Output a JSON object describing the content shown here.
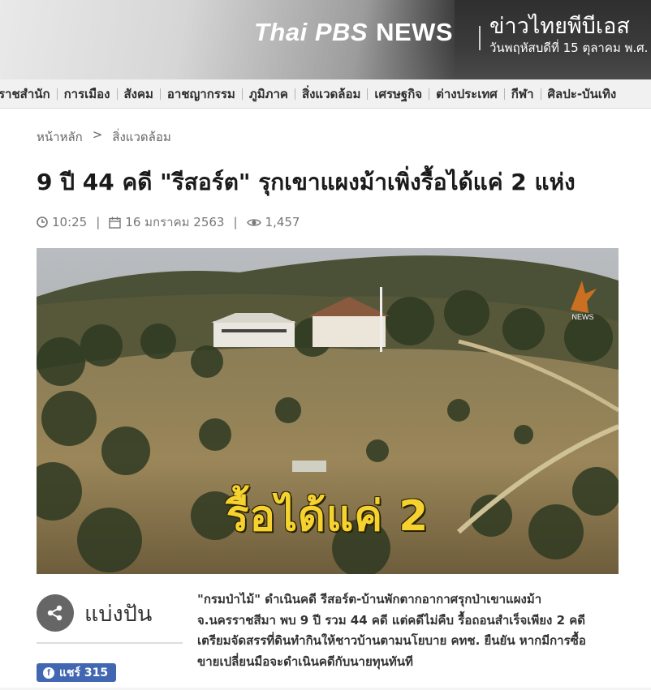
{
  "header": {
    "logo_brand": "Thai PBS",
    "logo_news": "NEWS",
    "thai_name": "ข่าวไทยพีบีเอส",
    "date_text": "วันพฤหัสบดีที่ 15 ตุลาคม พ.ศ."
  },
  "nav": {
    "items": [
      {
        "label": "ราชสำนัก"
      },
      {
        "label": "การเมือง"
      },
      {
        "label": "สังคม"
      },
      {
        "label": "อาชญากรรม"
      },
      {
        "label": "ภูมิภาค"
      },
      {
        "label": "สิ่งแวดล้อม"
      },
      {
        "label": "เศรษฐกิจ"
      },
      {
        "label": "ต่างประเทศ"
      },
      {
        "label": "กีฬา"
      },
      {
        "label": "ศิลปะ-บันเทิง"
      }
    ]
  },
  "breadcrumb": {
    "home": "หน้าหลัก",
    "separator": ">",
    "current": "สิ่งแวดล้อม"
  },
  "article": {
    "title": "9 ปี 44 คดี \"รีสอร์ต\" รุกเขาแผงม้าเพิ่งรื้อได้แค่ 2 แห่ง",
    "time": "10:25",
    "date": "16 มกราคม 2563",
    "views": "1,457",
    "meta_separator": "|",
    "image_caption": "รื้อได้แค่ 2",
    "image_watermark": "NEWS",
    "lead_lines": [
      "\"กรมป่าไม้\" ดำเนินคดี รีสอร์ต-บ้านพักตากอากาศรุกป่าเขาแผงม้า",
      "จ.นครราชสีมา พบ 9 ปี รวม 44 คดี แต่คดีไม่คืบ รื้อถอนสำเร็จเพียง 2 คดี",
      "เตรียมจัดสรรที่ดินทำกินให้ชาวบ้านตามนโยบาย คทช. ยืนยัน หากมีการซื้อ",
      "ขายเปลี่ยนมือจะดำเนินคดีกับนายทุนทันที"
    ]
  },
  "share": {
    "label": "แบ่งปัน",
    "fb_label": "แชร์ 315",
    "fb_icon_letter": "f"
  },
  "colors": {
    "caption_yellow": "#f5d22f",
    "facebook_blue": "#4267b2"
  },
  "icons": {
    "clock": "clock-icon",
    "calendar": "calendar-icon",
    "eye": "eye-icon",
    "share": "share-icon",
    "facebook": "facebook-icon"
  }
}
